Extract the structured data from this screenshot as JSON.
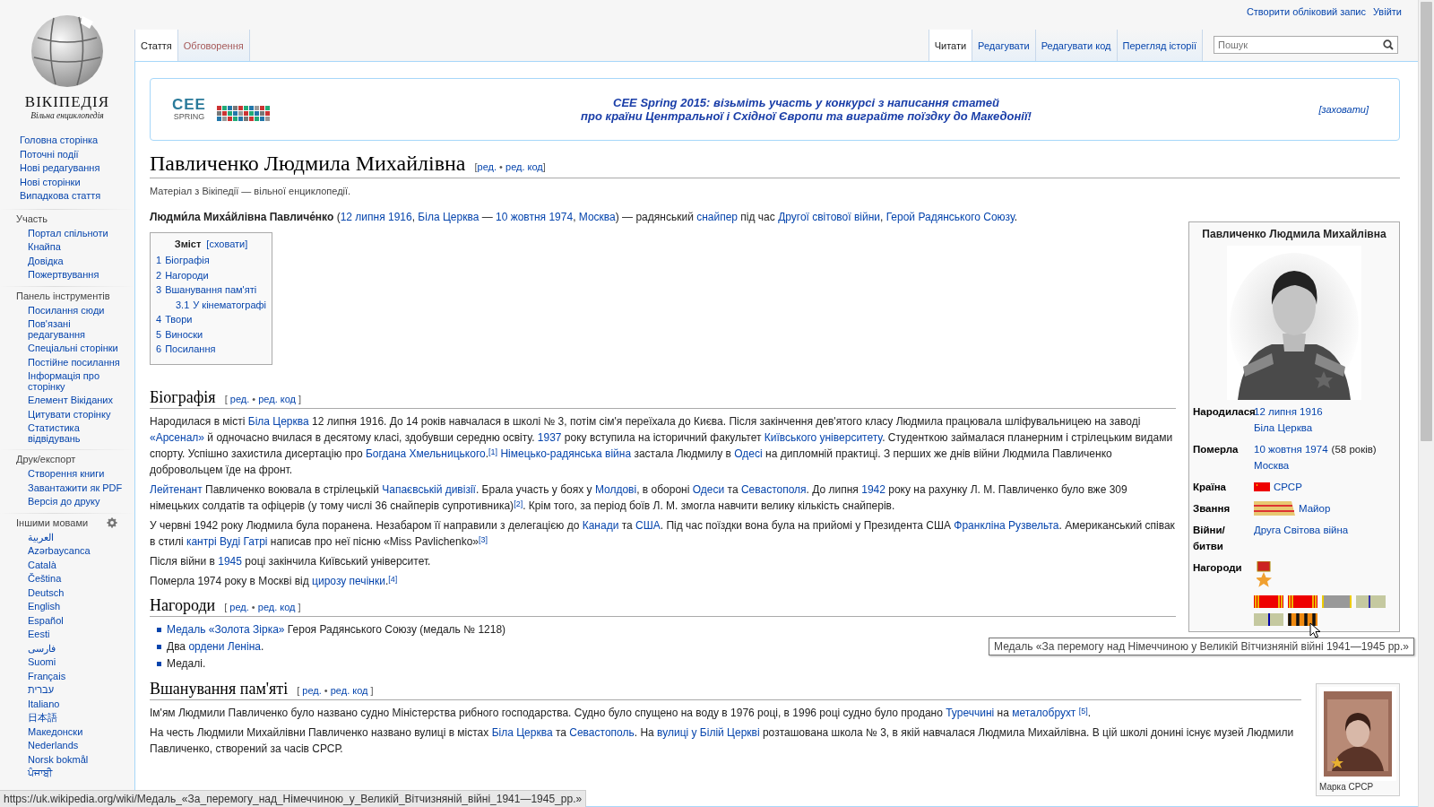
{
  "personal_links": [
    "Створити обліковий запис",
    "Увійти"
  ],
  "logo": {
    "wordmark": "ВІКІПЕДІЯ",
    "tagline": "Вільна енциклопедія"
  },
  "namespace_tabs": [
    {
      "label": "Стаття",
      "selected": true,
      "redlink": false
    },
    {
      "label": "Обговорення",
      "selected": false,
      "redlink": true
    }
  ],
  "view_tabs": [
    {
      "label": "Читати",
      "selected": true
    },
    {
      "label": "Редагувати",
      "selected": false
    },
    {
      "label": "Редагувати код",
      "selected": false
    },
    {
      "label": "Перегляд історії",
      "selected": false
    }
  ],
  "search": {
    "placeholder": "Пошук"
  },
  "sidebar": {
    "navigation": [
      "Головна сторінка",
      "Поточні події",
      "Нові редагування",
      "Нові сторінки",
      "Випадкова стаття"
    ],
    "sections": [
      {
        "heading": "Участь",
        "items": [
          "Портал спільноти",
          "Кнайпа",
          "Довідка",
          "Пожертвування"
        ]
      },
      {
        "heading": "Панель інструментів",
        "items": [
          "Посилання сюди",
          "Пов'язані редагування",
          "Спеціальні сторінки",
          "Постійне посилання",
          "Інформація про сторінку",
          "Елемент Вікіданих",
          "Цитувати сторінку",
          "Статистика відвідувань"
        ]
      },
      {
        "heading": "Друк/експорт",
        "items": [
          "Створення книги",
          "Завантажити як PDF",
          "Версія до друку"
        ]
      }
    ],
    "languages": {
      "heading": "Іншими мовами",
      "items": [
        "العربية",
        "Azərbaycanca",
        "Català",
        "Čeština",
        "Deutsch",
        "English",
        "Español",
        "Eesti",
        "فارسی",
        "Suomi",
        "Français",
        "עברית",
        "Italiano",
        "日本語",
        "Македонски",
        "Nederlands",
        "Norsk bokmål",
        "ਪੰਜਾਬੀ"
      ]
    }
  },
  "banner": {
    "logo_mark": "CEE",
    "logo_word": "SPRING",
    "lines": [
      "CEE Spring 2015: візьміть участь у конкурсі з написання статей",
      "про країни Центральної і Східної Європи та виграйте поїздку до Македонії!"
    ],
    "hide_link": "[заховати]"
  },
  "article": {
    "title": "Павличенко Людмила Михайлівна",
    "title_edit": [
      "[",
      {
        "kind": "link",
        "text": "ред."
      },
      " • ",
      {
        "kind": "link",
        "text": "ред. код"
      },
      "]"
    ],
    "site_sub": "Матеріал з Вікіпедії — вільної енциклопедії.",
    "infobox": {
      "title": "Павличенко Людмила Михайлівна",
      "rows": [
        {
          "kind": "plain",
          "label": "Народилася",
          "lines": [
            [
              {
                "kind": "link",
                "text": "12 липня 1916"
              }
            ],
            [
              {
                "kind": "link",
                "text": "Біла Церква"
              }
            ]
          ]
        },
        {
          "kind": "plain",
          "label": "Померла",
          "lines": [
            [
              {
                "kind": "link",
                "text": "10 жовтня 1974"
              },
              " (58 років)"
            ],
            [
              {
                "kind": "link",
                "text": "Москва"
              }
            ]
          ]
        },
        {
          "kind": "flag",
          "label": "Країна",
          "lines": [
            [
              {
                "kind": "link",
                "text": "СРСР"
              }
            ]
          ]
        },
        {
          "kind": "rank",
          "label": "Звання",
          "lines": [
            [
              {
                "kind": "link",
                "text": "Майор"
              }
            ]
          ]
        },
        {
          "kind": "plain",
          "label": "Війни/ битви",
          "lines": [
            [
              {
                "kind": "link",
                "text": "Друга Світова війна"
              }
            ]
          ]
        },
        {
          "kind": "awards",
          "label": "Нагороди"
        }
      ]
    },
    "intro": [
      {
        "kind": "bold",
        "text": "Людми́ла Миха́йлівна Павличе́нко"
      },
      " (",
      {
        "kind": "link",
        "text": "12 липня 1916"
      },
      ", ",
      {
        "kind": "link",
        "text": "Біла Церква"
      },
      " — ",
      {
        "kind": "link",
        "text": "10 жовтня 1974"
      },
      ", ",
      {
        "kind": "link",
        "text": "Москва"
      },
      ") — радянський ",
      {
        "kind": "link",
        "text": "снайпер"
      },
      " під час ",
      {
        "kind": "link",
        "text": "Другої світової війни"
      },
      ", ",
      {
        "kind": "link",
        "text": "Герой Радянського Союзу"
      },
      "."
    ],
    "toc": {
      "title": "Зміст",
      "toggle": "[сховати]",
      "items": [
        {
          "number": "1",
          "text": "Біографія"
        },
        {
          "number": "2",
          "text": "Нагороди"
        },
        {
          "number": "3",
          "text": "Вшанування пам'яті",
          "children": [
            {
              "number": "3.1",
              "text": "У кінематографі"
            }
          ]
        },
        {
          "number": "4",
          "text": "Твори"
        },
        {
          "number": "5",
          "text": "Виноски"
        },
        {
          "number": "6",
          "text": "Посилання"
        }
      ]
    },
    "sections": [
      {
        "heading": "Біографія",
        "edit": [
          "[ ",
          {
            "kind": "link",
            "text": "ред."
          },
          " • ",
          {
            "kind": "link",
            "text": "ред. код"
          },
          " ]"
        ],
        "paragraphs": [
          [
            "Народилася в місті ",
            {
              "kind": "link",
              "text": "Біла Церква"
            },
            " 12 липня 1916. До 14 років навчалася в школі № 3, потім сім'я переїхала до Києва. Після закінчення дев'ятого класу Людмила працювала шліфувальницею на заводі ",
            {
              "kind": "link",
              "text": "«Арсенал»"
            },
            " й одночасно вчилася в десятому класі, здобувши середню освіту. ",
            {
              "kind": "link",
              "text": "1937"
            },
            " року вступила на історичний факультет ",
            {
              "kind": "link",
              "text": "Київського університету"
            },
            ". Студенткою займалася планерним і стрілецьким видами спорту. Успішно захистила дисертацію про ",
            {
              "kind": "link",
              "text": "Богдана Хмельницького"
            },
            ".",
            {
              "kind": "ref",
              "text": "[1]"
            },
            {
              "kind": "link",
              "text": "Німецько-радянська війна"
            },
            " застала Людмилу в ",
            {
              "kind": "link",
              "text": "Одесі"
            },
            " на дипломній практиці. З перших же днів війни Людмила Павличенко добровольцем їде на фронт."
          ],
          [
            {
              "kind": "link",
              "text": "Лейтенант"
            },
            " Павличенко воювала в стрілецькій ",
            {
              "kind": "link",
              "text": "Чапаєвській дивізії"
            },
            ". Брала участь у боях у ",
            {
              "kind": "link",
              "text": "Молдові"
            },
            ", в обороні ",
            {
              "kind": "link",
              "text": "Одеси"
            },
            " та ",
            {
              "kind": "link",
              "text": "Севастополя"
            },
            ". До липня ",
            {
              "kind": "link",
              "text": "1942"
            },
            " року на рахунку Л. М. Павличенко було вже 309 німецьких солдатів та офіцерів (у тому числі 36 снайперів супротивника)",
            {
              "kind": "ref",
              "text": "[2]"
            },
            ". Крім того, за період боїв Л. М. змогла навчити велику кількість снайперів."
          ],
          [
            "У червні 1942 року Людмила була поранена. Незабаром її направили з делегацією до ",
            {
              "kind": "link",
              "text": "Канади"
            },
            " та ",
            {
              "kind": "link",
              "text": "США"
            },
            ". Під час поїздки вона була на прийомі у Президента США ",
            {
              "kind": "link",
              "text": "Франкліна Рузвельта"
            },
            ". Американський співак в стилі ",
            {
              "kind": "link",
              "text": "кантрі"
            },
            {
              "kind": "link",
              "text": "Вуді Гатрі"
            },
            " написав про неї пісню «Miss Pavlichenko»",
            {
              "kind": "ref",
              "text": "[3]"
            }
          ],
          [
            "Після війни в ",
            {
              "kind": "link",
              "text": "1945"
            },
            " році закінчила Київський університет."
          ],
          [
            "Померла 1974 року в Москві від ",
            {
              "kind": "link",
              "text": "цирозу печінки"
            },
            ".",
            {
              "kind": "ref",
              "text": "[4]"
            }
          ]
        ]
      },
      {
        "heading": "Нагороди",
        "edit": [
          "[ ",
          {
            "kind": "link",
            "text": "ред."
          },
          " • ",
          {
            "kind": "link",
            "text": "ред. код"
          },
          " ]"
        ],
        "list": [
          [
            {
              "kind": "link",
              "text": "Медаль «Золота Зірка»"
            },
            " Героя Радянського Союзу (медаль № 1218)"
          ],
          [
            "Два ",
            {
              "kind": "link",
              "text": "ордени Леніна"
            },
            "."
          ],
          [
            "Медалі."
          ]
        ]
      },
      {
        "heading": "Вшанування пам'яті",
        "edit": [
          "[ ",
          {
            "kind": "link",
            "text": "ред."
          },
          " • ",
          {
            "kind": "link",
            "text": "ред. код"
          },
          " ]"
        ],
        "figure": {
          "kind": "picture",
          "caption": "Марка СРСР"
        },
        "paragraphs": [
          [
            "Ім'ям Людмили Павличенко було названо судно Міністерства рибного господарства. Судно було спущено на воду в 1976 році, в 1996 році судно було продано ",
            {
              "kind": "link",
              "text": "Туреччині"
            },
            " на ",
            {
              "kind": "link",
              "text": "металобрухт"
            },
            {
              "kind": "ref",
              "text": "[5]"
            },
            "."
          ],
          [
            "На честь Людмили Михайлівни Павличенко названо вулиці в містах ",
            {
              "kind": "link",
              "text": "Біла Церква"
            },
            " та ",
            {
              "kind": "link",
              "text": "Севастополь"
            },
            ". На ",
            {
              "kind": "link",
              "text": "вулиці у Білій Церкві"
            },
            " розташована школа № 3, в якій навчалася Людмила Михайлівна. В цій школі донині існує музей Людмили Павличенко, створений за часів СРСР."
          ]
        ]
      }
    ]
  },
  "tooltip": "Медаль «За перемогу над Німеччиною у Великій Вітчизняній війні 1941—1945 рр.»",
  "status_bar": "https://uk.wikipedia.org/wiki/Медаль_«За_перемогу_над_Німеччиною_у_Великій_Вітчизняній_війні_1941—1945_рр.»"
}
